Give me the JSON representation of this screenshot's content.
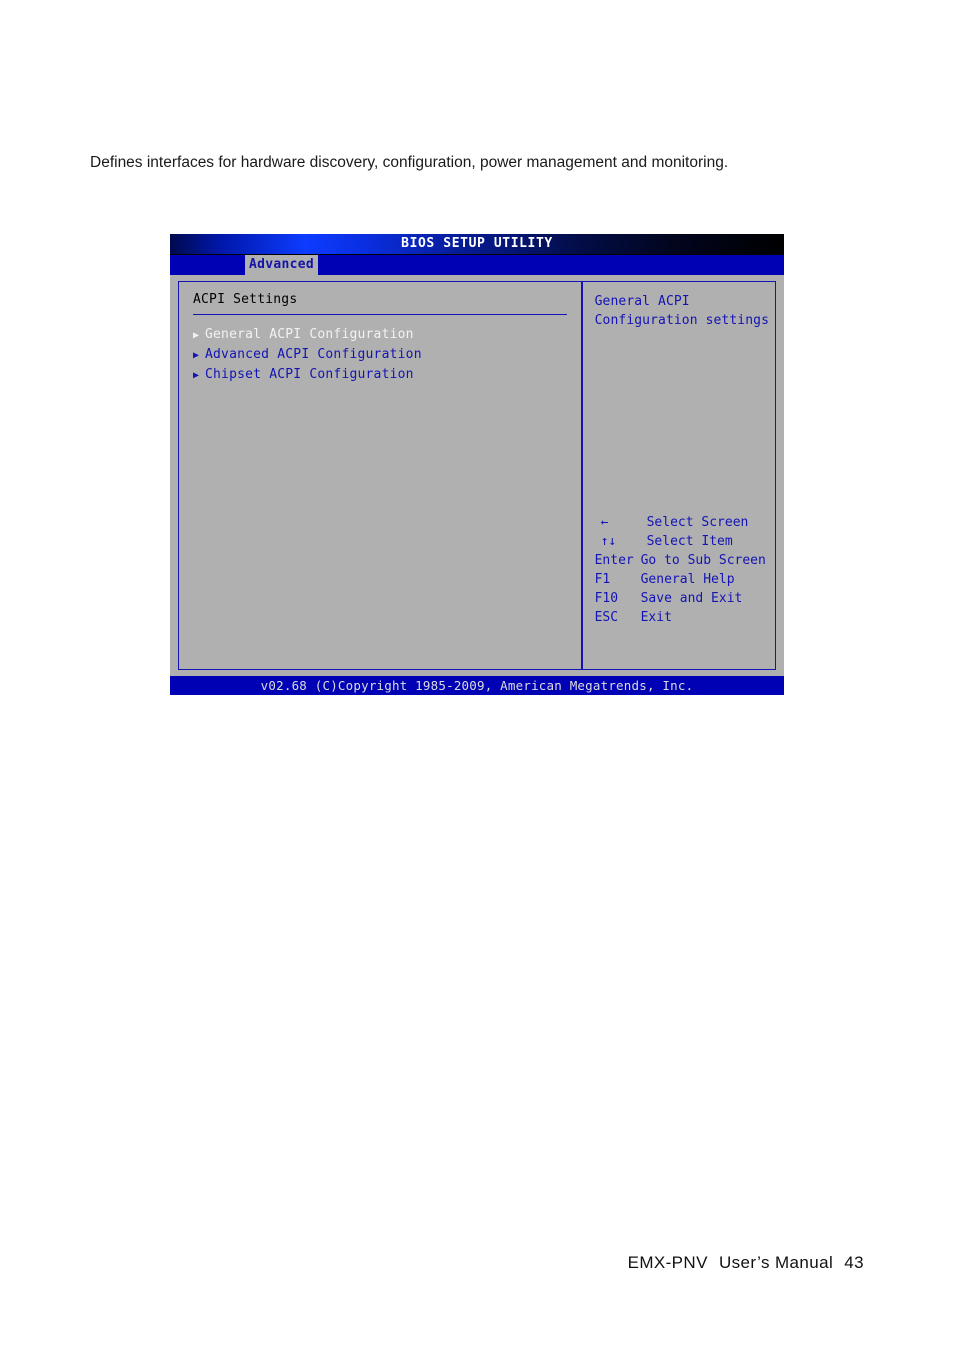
{
  "document": {
    "paragraph": "Defines interfaces for hardware discovery, configuration, power management and monitoring.",
    "footer": {
      "product": "EMX-PNV",
      "manual_label": "User’s  Manual",
      "page_number": "43"
    }
  },
  "bios": {
    "title": "BIOS SETUP UTILITY",
    "menu_tabs": [
      {
        "label": "Advanced",
        "active": true
      }
    ],
    "left_panel": {
      "section_title": "ACPI Settings",
      "items": [
        {
          "marker": "▶",
          "label": "General ACPI Configuration",
          "selected": true
        },
        {
          "marker": "▶",
          "label": "Advanced ACPI Configuration",
          "selected": false
        },
        {
          "marker": "▶",
          "label": "Chipset ACPI Configuration",
          "selected": false
        }
      ]
    },
    "right_panel": {
      "help_lines": [
        "General ACPI",
        "Configuration settings"
      ],
      "key_legend": [
        {
          "key": "←",
          "description": "Select Screen"
        },
        {
          "key": "↑↓",
          "description": "Select Item"
        },
        {
          "key": "Enter",
          "description": "Go to Sub Screen"
        },
        {
          "key": "F1",
          "description": "General Help"
        },
        {
          "key": "F10",
          "description": "Save and Exit"
        },
        {
          "key": "ESC",
          "description": "Exit"
        }
      ]
    },
    "status_bar": "v02.68 (C)Copyright 1985-2009, American Megatrends, Inc.",
    "colors": {
      "titlebar_blue": "#0d3cff",
      "menubar_blue": "#0000b5",
      "panel_grey": "#b0b0b0",
      "text_blue": "#1414b4",
      "selected_text": "#f2f2f2",
      "status_text": "#dcdcdc"
    }
  }
}
